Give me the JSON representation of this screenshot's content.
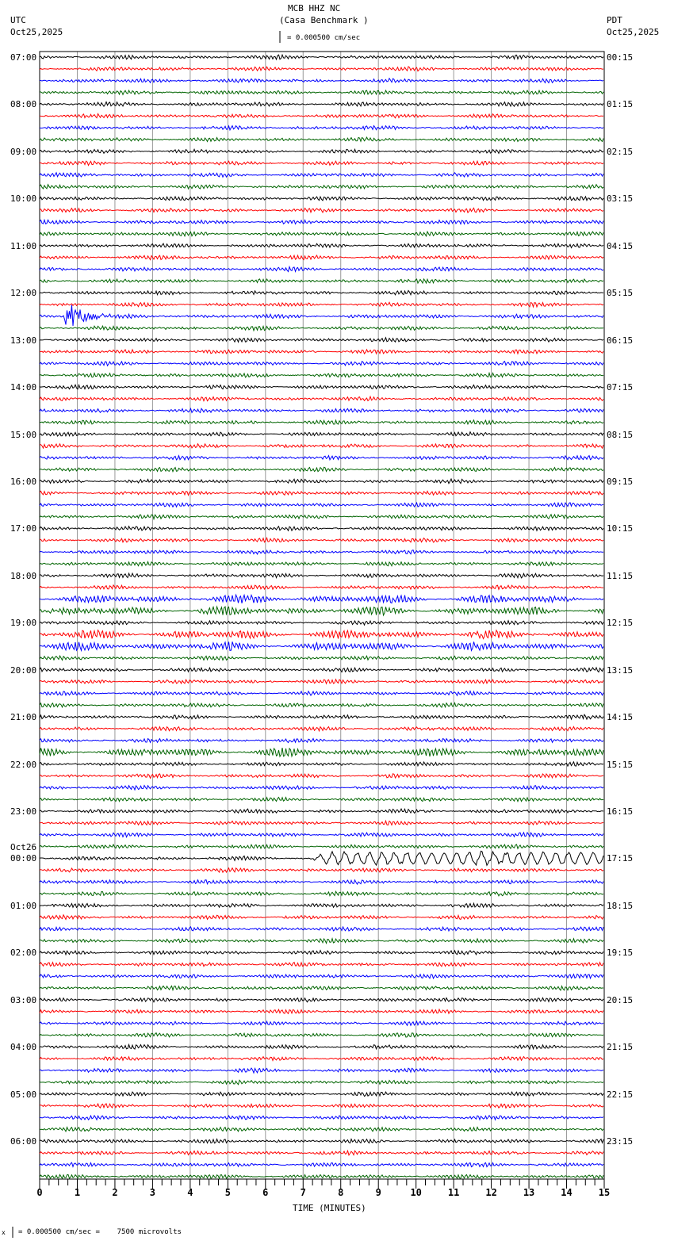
{
  "header": {
    "station": "MCB HHZ NC",
    "site": "(Casa Benchmark )",
    "left_tz": "UTC",
    "left_date": "Oct25,2025",
    "right_tz": "PDT",
    "right_date": "Oct25,2025",
    "scale_text": "= 0.000500 cm/sec"
  },
  "footer": {
    "scale_text": "= 0.000500 cm/sec =    7500 microvolts",
    "prefix": "x"
  },
  "chart_data": {
    "type": "line",
    "title": "MCB HHZ NC (Casa Benchmark )",
    "xlabel": "TIME (MINUTES)",
    "xlim": [
      0,
      15
    ],
    "x_ticks": [
      "0",
      "1",
      "2",
      "3",
      "4",
      "5",
      "6",
      "7",
      "8",
      "9",
      "10",
      "11",
      "12",
      "13",
      "14",
      "15"
    ],
    "traces_per_hour": 4,
    "trace_colors": [
      "#000000",
      "#ff0000",
      "#0000ff",
      "#006400"
    ],
    "left_labels": [
      "07:00",
      "08:00",
      "09:00",
      "10:00",
      "11:00",
      "12:00",
      "13:00",
      "14:00",
      "15:00",
      "16:00",
      "17:00",
      "18:00",
      "19:00",
      "20:00",
      "21:00",
      "22:00",
      "23:00",
      "00:00",
      "01:00",
      "02:00",
      "03:00",
      "04:00",
      "05:00",
      "06:00"
    ],
    "date_change_label": "Oct26",
    "right_labels": [
      "00:15",
      "01:15",
      "02:15",
      "03:15",
      "04:15",
      "05:15",
      "06:15",
      "07:15",
      "08:15",
      "09:15",
      "10:15",
      "11:15",
      "12:15",
      "13:15",
      "14:15",
      "15:15",
      "16:15",
      "17:15",
      "18:15",
      "19:15",
      "20:15",
      "21:15",
      "22:15",
      "23:15"
    ],
    "events": [
      {
        "trace_start_utc": "12:30",
        "start_min": 0.65,
        "end_min": 2.0,
        "amplitude": "large"
      },
      {
        "trace_start_utc": "00:00",
        "start_min": 7.2,
        "end_min": 15,
        "amplitude": "long-period swell"
      }
    ],
    "noisy_traces_utc": [
      "18:30",
      "18:45",
      "19:15",
      "19:30",
      "21:45"
    ]
  }
}
